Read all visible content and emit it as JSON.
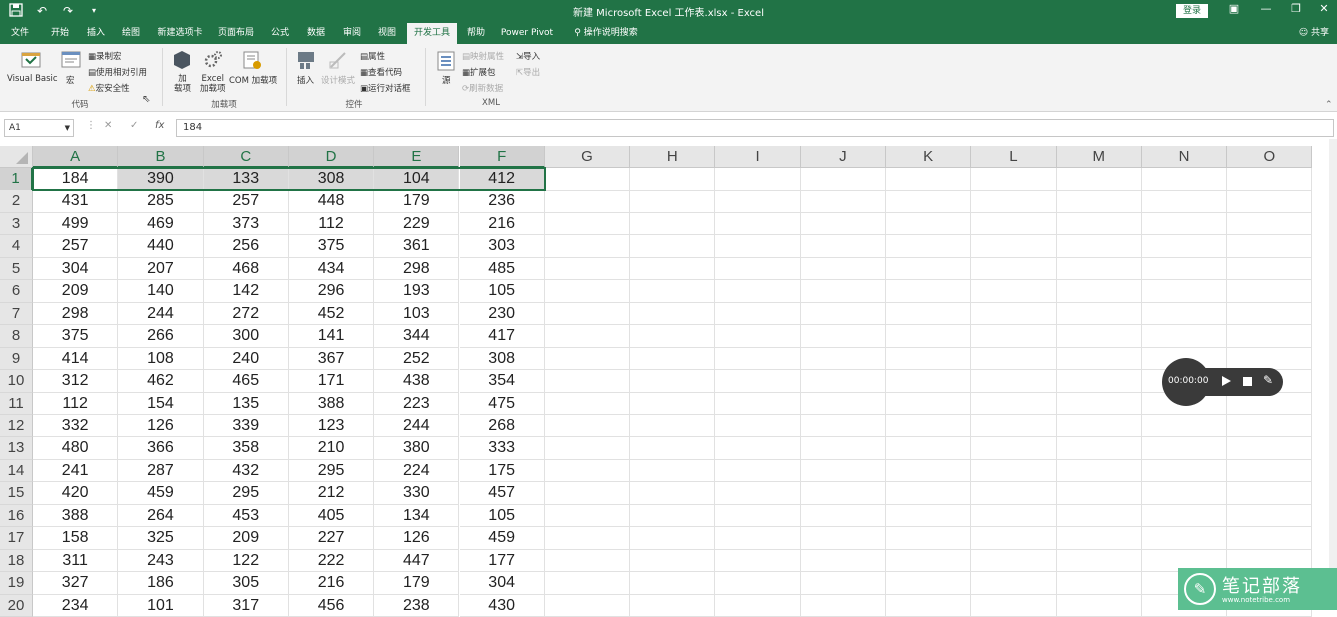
{
  "window": {
    "title": "新建 Microsoft Excel 工作表.xlsx - Excel",
    "login_label": "登录",
    "share_label": "共享"
  },
  "tabs": [
    {
      "label": "文件"
    },
    {
      "label": "开始"
    },
    {
      "label": "插入"
    },
    {
      "label": "绘图"
    },
    {
      "label": "新建选项卡"
    },
    {
      "label": "页面布局"
    },
    {
      "label": "公式"
    },
    {
      "label": "数据"
    },
    {
      "label": "审阅"
    },
    {
      "label": "视图"
    },
    {
      "label": "开发工具",
      "active": true
    },
    {
      "label": "帮助"
    },
    {
      "label": "Power Pivot"
    },
    {
      "label": "操作说明搜索"
    }
  ],
  "ribbon": {
    "code": {
      "visual_basic": "Visual Basic",
      "macro": "宏",
      "record_macro": "录制宏",
      "relative_ref": "使用相对引用",
      "macro_security": "宏安全性",
      "label": "代码"
    },
    "addins": {
      "addins": "加\n载项",
      "excel_addins": "Excel\n加载项",
      "com_addins": "COM 加载项",
      "label": "加载项"
    },
    "controls": {
      "insert": "插入",
      "design_mode": "设计模式",
      "properties": "属性",
      "view_code": "查看代码",
      "run_dialog": "运行对话框",
      "label": "控件"
    },
    "xml": {
      "source": "源",
      "map_properties": "映射属性",
      "expansion_packs": "扩展包",
      "refresh_data": "刷新数据",
      "import": "导入",
      "export": "导出",
      "label": "XML"
    }
  },
  "formula_bar": {
    "name_box": "A1",
    "cancel": "✕",
    "enter": "✓",
    "fx": "fx",
    "value": "184"
  },
  "sheet": {
    "columns": [
      "A",
      "B",
      "C",
      "D",
      "E",
      "F",
      "G",
      "H",
      "I",
      "J",
      "K",
      "L",
      "M",
      "N",
      "O"
    ],
    "rows": [
      [
        "184",
        "390",
        "133",
        "308",
        "104",
        "412"
      ],
      [
        "431",
        "285",
        "257",
        "448",
        "179",
        "236"
      ],
      [
        "499",
        "469",
        "373",
        "112",
        "229",
        "216"
      ],
      [
        "257",
        "440",
        "256",
        "375",
        "361",
        "303"
      ],
      [
        "304",
        "207",
        "468",
        "434",
        "298",
        "485"
      ],
      [
        "209",
        "140",
        "142",
        "296",
        "193",
        "105"
      ],
      [
        "298",
        "244",
        "272",
        "452",
        "103",
        "230"
      ],
      [
        "375",
        "266",
        "300",
        "141",
        "344",
        "417"
      ],
      [
        "414",
        "108",
        "240",
        "367",
        "252",
        "308"
      ],
      [
        "312",
        "462",
        "465",
        "171",
        "438",
        "354"
      ],
      [
        "112",
        "154",
        "135",
        "388",
        "223",
        "475"
      ],
      [
        "332",
        "126",
        "339",
        "123",
        "244",
        "268"
      ],
      [
        "480",
        "366",
        "358",
        "210",
        "380",
        "333"
      ],
      [
        "241",
        "287",
        "432",
        "295",
        "224",
        "175"
      ],
      [
        "420",
        "459",
        "295",
        "212",
        "330",
        "457"
      ],
      [
        "388",
        "264",
        "453",
        "405",
        "134",
        "105"
      ],
      [
        "158",
        "325",
        "209",
        "227",
        "126",
        "459"
      ],
      [
        "311",
        "243",
        "122",
        "222",
        "447",
        "177"
      ],
      [
        "327",
        "186",
        "305",
        "216",
        "179",
        "304"
      ],
      [
        "234",
        "101",
        "317",
        "456",
        "238",
        "430"
      ]
    ]
  },
  "recorder": {
    "time": "00:00:00"
  },
  "watermark": {
    "title": "笔记部落",
    "url": "www.notetribe.com"
  }
}
